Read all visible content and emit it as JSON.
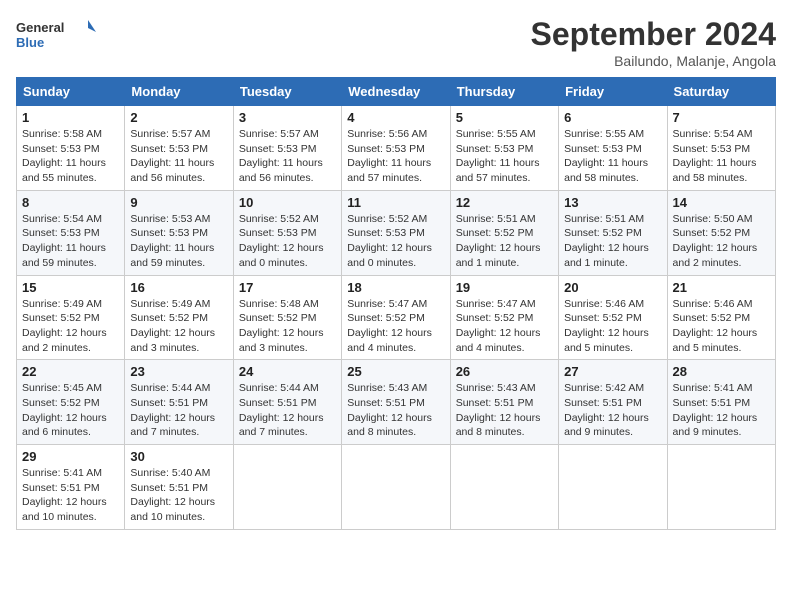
{
  "header": {
    "logo_general": "General",
    "logo_blue": "Blue",
    "month": "September 2024",
    "location": "Bailundo, Malanje, Angola"
  },
  "days_of_week": [
    "Sunday",
    "Monday",
    "Tuesday",
    "Wednesday",
    "Thursday",
    "Friday",
    "Saturday"
  ],
  "weeks": [
    [
      {
        "day": "1",
        "sunrise": "5:58 AM",
        "sunset": "5:53 PM",
        "daylight": "11 hours and 55 minutes."
      },
      {
        "day": "2",
        "sunrise": "5:57 AM",
        "sunset": "5:53 PM",
        "daylight": "11 hours and 56 minutes."
      },
      {
        "day": "3",
        "sunrise": "5:57 AM",
        "sunset": "5:53 PM",
        "daylight": "11 hours and 56 minutes."
      },
      {
        "day": "4",
        "sunrise": "5:56 AM",
        "sunset": "5:53 PM",
        "daylight": "11 hours and 57 minutes."
      },
      {
        "day": "5",
        "sunrise": "5:55 AM",
        "sunset": "5:53 PM",
        "daylight": "11 hours and 57 minutes."
      },
      {
        "day": "6",
        "sunrise": "5:55 AM",
        "sunset": "5:53 PM",
        "daylight": "11 hours and 58 minutes."
      },
      {
        "day": "7",
        "sunrise": "5:54 AM",
        "sunset": "5:53 PM",
        "daylight": "11 hours and 58 minutes."
      }
    ],
    [
      {
        "day": "8",
        "sunrise": "5:54 AM",
        "sunset": "5:53 PM",
        "daylight": "11 hours and 59 minutes."
      },
      {
        "day": "9",
        "sunrise": "5:53 AM",
        "sunset": "5:53 PM",
        "daylight": "11 hours and 59 minutes."
      },
      {
        "day": "10",
        "sunrise": "5:52 AM",
        "sunset": "5:53 PM",
        "daylight": "12 hours and 0 minutes."
      },
      {
        "day": "11",
        "sunrise": "5:52 AM",
        "sunset": "5:53 PM",
        "daylight": "12 hours and 0 minutes."
      },
      {
        "day": "12",
        "sunrise": "5:51 AM",
        "sunset": "5:52 PM",
        "daylight": "12 hours and 1 minute."
      },
      {
        "day": "13",
        "sunrise": "5:51 AM",
        "sunset": "5:52 PM",
        "daylight": "12 hours and 1 minute."
      },
      {
        "day": "14",
        "sunrise": "5:50 AM",
        "sunset": "5:52 PM",
        "daylight": "12 hours and 2 minutes."
      }
    ],
    [
      {
        "day": "15",
        "sunrise": "5:49 AM",
        "sunset": "5:52 PM",
        "daylight": "12 hours and 2 minutes."
      },
      {
        "day": "16",
        "sunrise": "5:49 AM",
        "sunset": "5:52 PM",
        "daylight": "12 hours and 3 minutes."
      },
      {
        "day": "17",
        "sunrise": "5:48 AM",
        "sunset": "5:52 PM",
        "daylight": "12 hours and 3 minutes."
      },
      {
        "day": "18",
        "sunrise": "5:47 AM",
        "sunset": "5:52 PM",
        "daylight": "12 hours and 4 minutes."
      },
      {
        "day": "19",
        "sunrise": "5:47 AM",
        "sunset": "5:52 PM",
        "daylight": "12 hours and 4 minutes."
      },
      {
        "day": "20",
        "sunrise": "5:46 AM",
        "sunset": "5:52 PM",
        "daylight": "12 hours and 5 minutes."
      },
      {
        "day": "21",
        "sunrise": "5:46 AM",
        "sunset": "5:52 PM",
        "daylight": "12 hours and 5 minutes."
      }
    ],
    [
      {
        "day": "22",
        "sunrise": "5:45 AM",
        "sunset": "5:52 PM",
        "daylight": "12 hours and 6 minutes."
      },
      {
        "day": "23",
        "sunrise": "5:44 AM",
        "sunset": "5:51 PM",
        "daylight": "12 hours and 7 minutes."
      },
      {
        "day": "24",
        "sunrise": "5:44 AM",
        "sunset": "5:51 PM",
        "daylight": "12 hours and 7 minutes."
      },
      {
        "day": "25",
        "sunrise": "5:43 AM",
        "sunset": "5:51 PM",
        "daylight": "12 hours and 8 minutes."
      },
      {
        "day": "26",
        "sunrise": "5:43 AM",
        "sunset": "5:51 PM",
        "daylight": "12 hours and 8 minutes."
      },
      {
        "day": "27",
        "sunrise": "5:42 AM",
        "sunset": "5:51 PM",
        "daylight": "12 hours and 9 minutes."
      },
      {
        "day": "28",
        "sunrise": "5:41 AM",
        "sunset": "5:51 PM",
        "daylight": "12 hours and 9 minutes."
      }
    ],
    [
      {
        "day": "29",
        "sunrise": "5:41 AM",
        "sunset": "5:51 PM",
        "daylight": "12 hours and 10 minutes."
      },
      {
        "day": "30",
        "sunrise": "5:40 AM",
        "sunset": "5:51 PM",
        "daylight": "12 hours and 10 minutes."
      },
      null,
      null,
      null,
      null,
      null
    ]
  ],
  "labels": {
    "sunrise": "Sunrise:",
    "sunset": "Sunset:",
    "daylight": "Daylight:"
  }
}
